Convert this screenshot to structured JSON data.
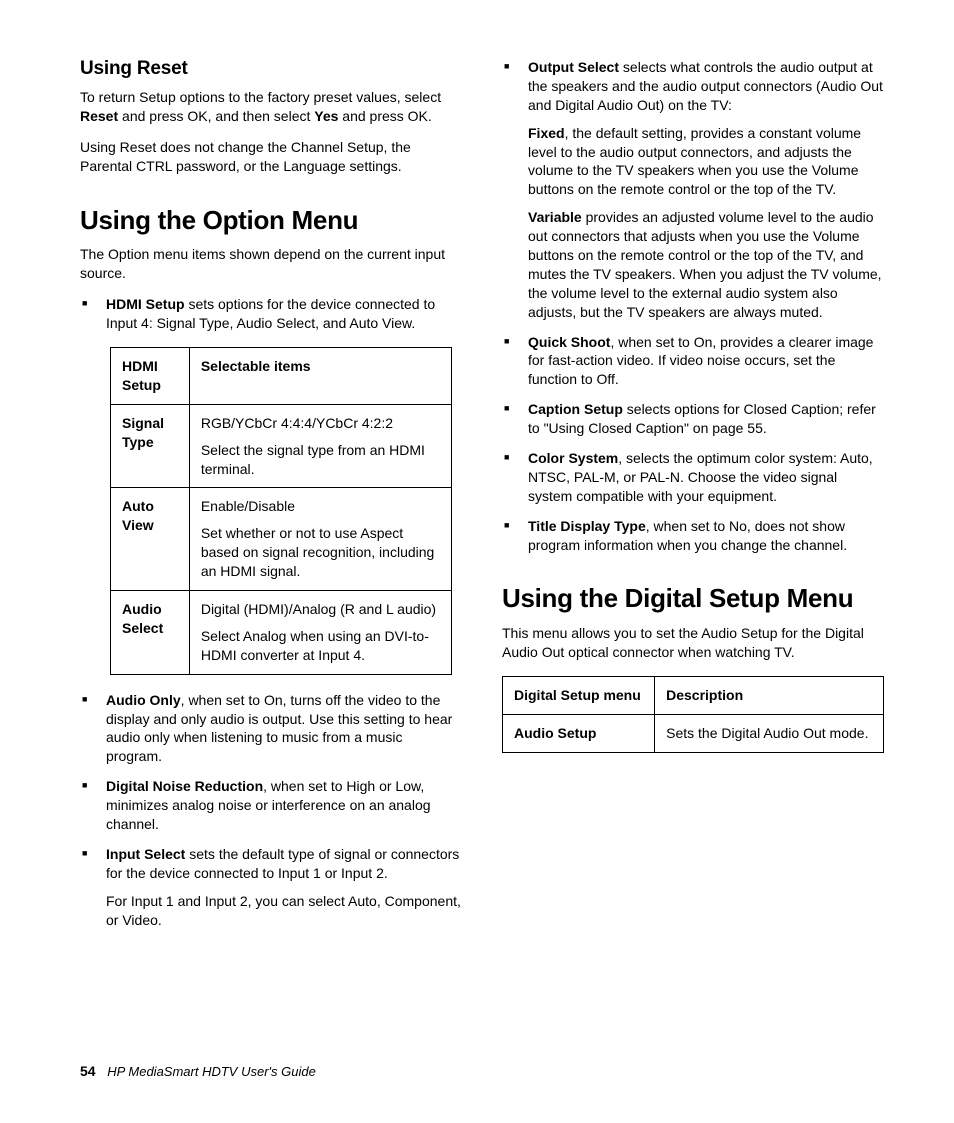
{
  "left": {
    "h2_reset": "Using Reset",
    "reset_p1a": "To return Setup options to the factory preset values, select ",
    "reset_p1b": "Reset",
    "reset_p1c": " and press OK, and then select ",
    "reset_p1d": "Yes",
    "reset_p1e": " and press OK.",
    "reset_p2": "Using Reset does not change the Channel Setup, the Parental CTRL password, or the Language settings.",
    "h1_option": "Using the Option Menu",
    "option_p1": "The Option menu items shown depend on the current input source.",
    "li_hdmi_b": "HDMI Setup",
    "li_hdmi_t": " sets options for the device connected to Input 4: Signal Type, Audio Select, and Auto View.",
    "t1": {
      "h1": "HDMI Setup",
      "h2": "Selectable items",
      "r1c1": "Signal Type",
      "r1c2a": "RGB/YCbCr 4:4:4/YCbCr 4:2:2",
      "r1c2b": "Select the signal type from an HDMI terminal.",
      "r2c1": "Auto View",
      "r2c2a": "Enable/Disable",
      "r2c2b": "Set whether or not to use Aspect based on signal recognition, including an HDMI signal.",
      "r3c1": "Audio Select",
      "r3c2a": "Digital (HDMI)/Analog (R and L audio)",
      "r3c2b": "Select Analog when using an DVI-to-HDMI converter at Input 4."
    },
    "li_audio_b": "Audio Only",
    "li_audio_t": ", when set to On, turns off the video to the display and only audio is output. Use this setting to hear audio only when listening to music from a music program.",
    "li_dnr_b": "Digital Noise Reduction",
    "li_dnr_t": ", when set to High or Low, minimizes analog noise or interference on an analog channel.",
    "li_input_b": "Input Select",
    "li_input_t": " sets the default type of signal or connectors for the device connected to Input 1 or Input 2.",
    "li_input_p": "For Input 1 and Input 2, you can select Auto, Component, or Video."
  },
  "right": {
    "li_out_b": "Output Select",
    "li_out_t": " selects what controls the audio output at the speakers and the audio output connectors (Audio Out and Digital Audio Out) on the TV:",
    "li_out_fixed_b": "Fixed",
    "li_out_fixed_t": ", the default setting, provides a constant volume level to the audio output connectors, and adjusts the volume to the TV speakers when you use the Volume buttons on the remote control or the top of the TV.",
    "li_out_var_b": "Variable",
    "li_out_var_t": " provides an adjusted volume level to the audio out connectors that adjusts when you use the Volume buttons on the remote control or the top of the TV, and mutes the TV speakers. When you adjust the TV volume, the volume level to the external audio system also adjusts, but the TV speakers are always muted.",
    "li_qs_b": "Quick Shoot",
    "li_qs_t": ", when set to On, provides a clearer image for fast-action video. If video noise occurs, set the function to Off.",
    "li_cap_b": "Caption Setup",
    "li_cap_t": " selects options for Closed Caption; refer to \"Using Closed Caption\" on page 55.",
    "li_cs_b": "Color System",
    "li_cs_t": ", selects the optimum color system: Auto, NTSC, PAL-M, or PAL-N. Choose the video signal system compatible with your equipment.",
    "li_tdt_b": "Title Display Type",
    "li_tdt_t": ", when set to No, does not show program information when you change the channel.",
    "h1_digital": "Using the Digital Setup Menu",
    "digital_p1": "This menu allows you to set the Audio Setup for the Digital Audio Out optical connector when watching TV.",
    "t2": {
      "h1": "Digital Setup menu",
      "h2": "Description",
      "r1c1": "Audio Setup",
      "r1c2": "Sets the Digital Audio Out mode."
    }
  },
  "footer": {
    "page": "54",
    "doc": "HP MediaSmart HDTV User's Guide"
  }
}
